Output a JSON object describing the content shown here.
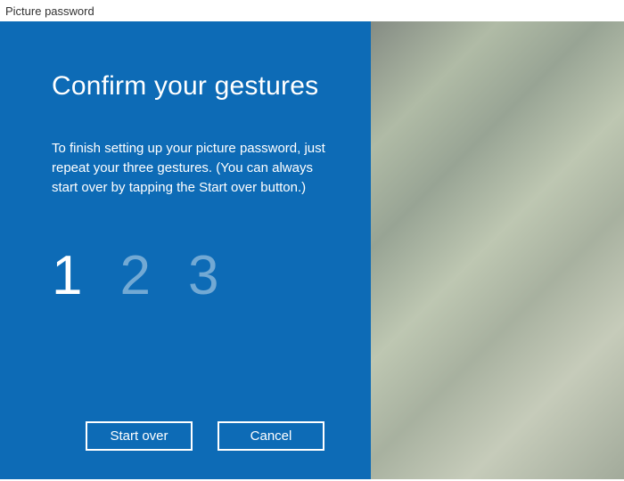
{
  "window": {
    "title": "Picture password"
  },
  "panel": {
    "heading": "Confirm your gestures",
    "body": "To finish setting up your picture password, just repeat your three gestures. (You can always start over by tapping the Start over button.)"
  },
  "steps": {
    "items": [
      "1",
      "2",
      "3"
    ],
    "active_index": 0
  },
  "buttons": {
    "start_over": "Start over",
    "cancel": "Cancel"
  }
}
